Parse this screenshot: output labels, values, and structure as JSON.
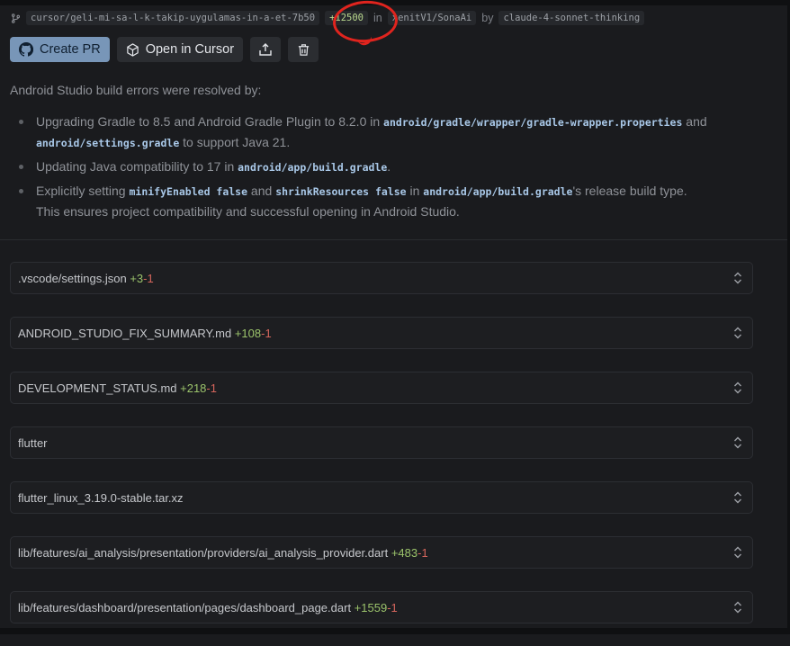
{
  "header": {
    "branch": "cursor/geli-mi-sa-l-k-takip-uygulamas-in-a-et-7b50",
    "lines_changed": "+12500",
    "in_label": "in",
    "repo": "xenitV1/SonaAi",
    "by_label": "by",
    "model": "claude-4-sonnet-thinking"
  },
  "buttons": {
    "create_pr": "Create PR",
    "open_in_cursor": "Open in Cursor"
  },
  "summary": {
    "intro": "Android Studio build errors were resolved by:",
    "b1_t1": "Upgrading Gradle to 8.5 and Android Gradle Plugin to 8.2.0 in ",
    "b1_c1": "android/gradle/wrapper/gradle-wrapper.properties",
    "b1_t2": " and ",
    "b1_c2": "android/settings.gradle",
    "b1_t3": " to support Java 21.",
    "b2_t1": "Updating Java compatibility to 17 in ",
    "b2_c1": "android/app/build.gradle",
    "b2_t2": ".",
    "b3_t1": "Explicitly setting ",
    "b3_c1": "minifyEnabled false",
    "b3_t2": " and ",
    "b3_c2": "shrinkResources false",
    "b3_t3": " in ",
    "b3_c3": "android/app/build.gradle",
    "b3_t4": "'s release build type.",
    "b3_t5": "This ensures project compatibility and successful opening in Android Studio."
  },
  "files": [
    {
      "name": ".vscode/settings.json",
      "add": "+3",
      "del": "-1"
    },
    {
      "name": "ANDROID_STUDIO_FIX_SUMMARY.md",
      "add": "+108",
      "del": "-1"
    },
    {
      "name": "DEVELOPMENT_STATUS.md",
      "add": "+218",
      "del": "-1"
    },
    {
      "name": "flutter",
      "add": "",
      "del": ""
    },
    {
      "name": "flutter_linux_3.19.0-stable.tar.xz",
      "add": "",
      "del": ""
    },
    {
      "name": "lib/features/ai_analysis/presentation/providers/ai_analysis_provider.dart",
      "add": "+483",
      "del": "-1"
    },
    {
      "name": "lib/features/dashboard/presentation/pages/dashboard_page.dart",
      "add": "+1559",
      "del": "-1"
    }
  ],
  "icons": {
    "branch": "git-branch-icon",
    "github": "github-icon",
    "cursor": "cursor-cube-icon",
    "share": "share-upload-icon",
    "delete": "trash-icon",
    "expand": "chevron-up-down-icon"
  },
  "colors": {
    "annotation": "#e0241e",
    "additions": "#9bc36b",
    "deletions": "#d4655c",
    "primary_button": "#7896b8"
  }
}
